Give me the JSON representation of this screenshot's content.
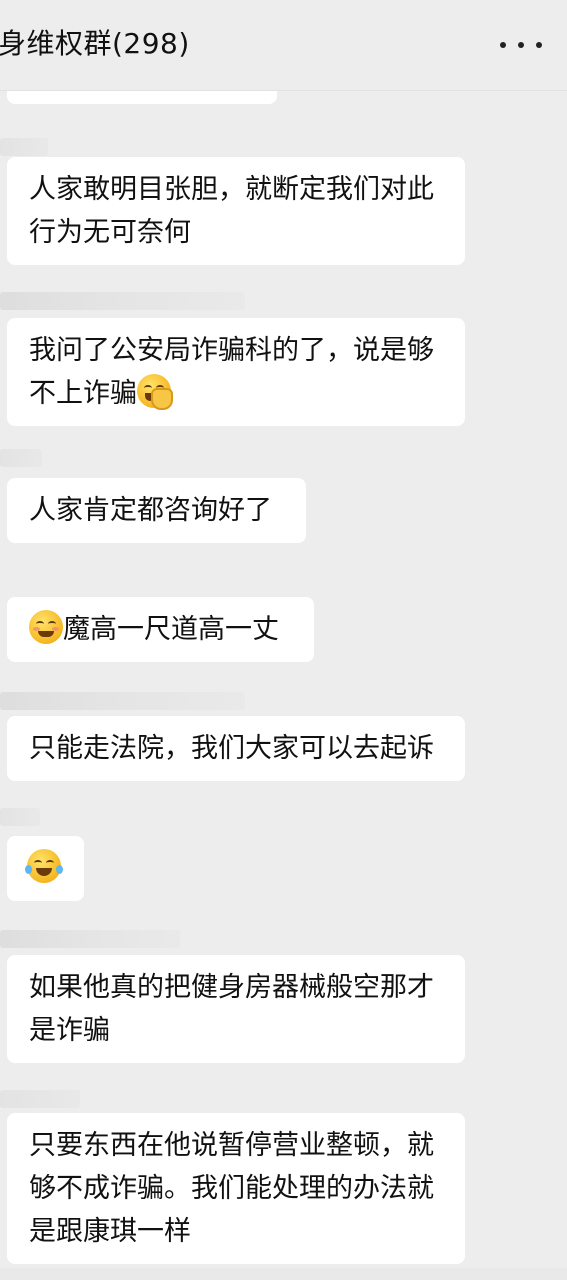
{
  "header": {
    "title": "身维权群(298)",
    "more_icon": "more-dots-icon"
  },
  "messages": [
    {
      "lines": [
        "人家敢明目张胆，就断定我们对此",
        "行为无可奈何"
      ]
    },
    {
      "lines": [
        "我问了公安局诈骗科的了，说是够",
        "不上诈骗"
      ],
      "trailing_emoji": "facepalm-emoji"
    },
    {
      "lines": [
        "人家肯定都咨询好了"
      ]
    },
    {
      "leading_emoji": "blushing-smile-emoji",
      "lines": [
        "魔高一尺道高一丈"
      ]
    },
    {
      "lines": [
        "只能走法院，我们大家可以去起诉"
      ]
    },
    {
      "emoji_only": "tears-of-joy-emoji"
    },
    {
      "lines": [
        "如果他真的把健身房器械般空那才",
        "是诈骗"
      ]
    },
    {
      "lines": [
        "只要东西在他说暂停营业整顿，就",
        "够不成诈骗。我们能处理的办法就",
        "是跟康琪一样"
      ]
    }
  ],
  "colors": {
    "background": "#ededed",
    "bubble": "#ffffff",
    "text": "#111111"
  }
}
